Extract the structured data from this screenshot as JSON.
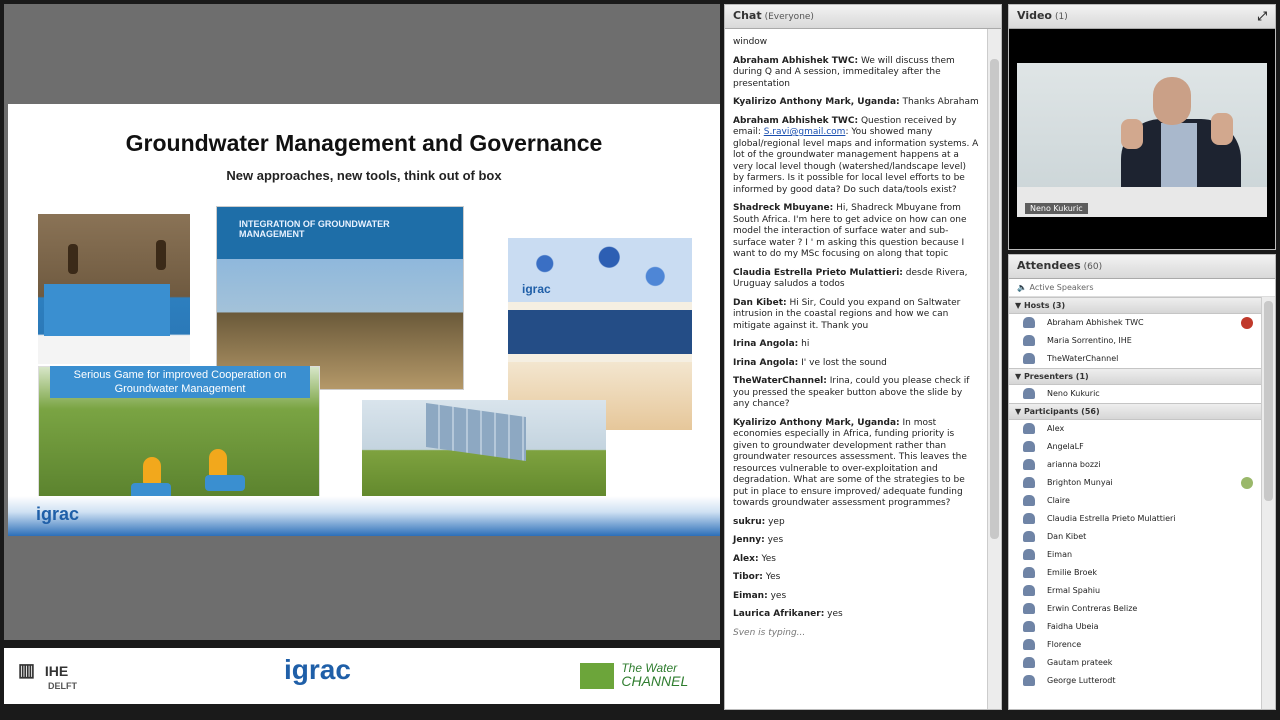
{
  "slide": {
    "title": "Groundwater Management and Governance",
    "subtitle": "New approaches, new tools, think out of box",
    "book_title": "INTEGRATION OF GROUNDWATER MANAGEMENT",
    "book3_logo": "igrac",
    "game_caption": "Serious Game for improved Cooperation on Groundwater Management",
    "footer_logo": "igrac"
  },
  "logobar": {
    "ihe": "IHE",
    "ihe_sub": "DELFT",
    "igrac": "igrac",
    "water_channel_1": "The Water",
    "water_channel_2": "CHANNEL"
  },
  "chat": {
    "title": "Chat",
    "scope": "(Everyone)",
    "messages": [
      {
        "author": "",
        "text": "window"
      },
      {
        "author": "Abraham Abhishek TWC:",
        "text": "We will discuss them during Q and A session, immeditaley after the presentation"
      },
      {
        "author": "Kyalirizo Anthony Mark, Uganda:",
        "text": "Thanks Abraham"
      },
      {
        "author": "Abraham Abhishek TWC:",
        "text": "Question received by email:",
        "link": "S.ravi@gmail.com",
        "text2": ": You showed many global/regional level maps and information systems. A lot of the groundwater management happens at a very local level though (watershed/landscape level) by farmers. Is it possible for local level efforts to be informed by good data? Do such  data/tools exist?"
      },
      {
        "author": "Shadreck Mbuyane:",
        "text": "Hi, Shadreck Mbuyane from South Africa. I'm here to get advice on how can one model the interaction of surface water and sub-surface water ? I ' m asking this question because I want to do my MSc focusing on along that topic"
      },
      {
        "author": "Claudia Estrella Prieto Mulattieri:",
        "text": "desde Rivera, Uruguay saludos a todos"
      },
      {
        "author": "Dan Kibet:",
        "text": "Hi Sir, Could you expand on Saltwater intrusion in the coastal regions and how we can mitigate against it. Thank you"
      },
      {
        "author": "Irina Angola:",
        "text": "hi"
      },
      {
        "author": "Irina Angola:",
        "text": "I' ve lost the sound"
      },
      {
        "author": "TheWaterChannel:",
        "text": "Irina, could you please check if you pressed the speaker button above the slide  by any chance?"
      },
      {
        "author": "Kyalirizo Anthony Mark, Uganda:",
        "text": "In most economies especially in Africa, funding priority is given to groundwater development rather than groundwater resources assessment. This leaves the resources vulnerable to over-exploitation and degradation. What are some of the strategies to be put in place to ensure improved/ adequate funding towards groundwater assessment programmes?"
      },
      {
        "author": "sukru:",
        "text": "yep"
      },
      {
        "author": "Jenny:",
        "text": "yes"
      },
      {
        "author": "Alex:",
        "text": "Yes"
      },
      {
        "author": "Tibor:",
        "text": "Yes"
      },
      {
        "author": "Eiman:",
        "text": "yes"
      },
      {
        "author": "Laurica Afrikaner:",
        "text": "yes"
      }
    ],
    "typing": "Sven is typing..."
  },
  "video": {
    "title": "Video",
    "count": "(1)",
    "presenter_name": "Neno Kukuric"
  },
  "attendees": {
    "title": "Attendees",
    "count": "(60)",
    "active_speakers": "Active Speakers",
    "groups": [
      {
        "label": "Hosts (3)",
        "members": [
          "Abraham Abhishek TWC",
          "Maria Sorrentino, IHE",
          "TheWaterChannel"
        ]
      },
      {
        "label": "Presenters (1)",
        "members": [
          "Neno Kukuric"
        ]
      },
      {
        "label": "Participants (56)",
        "members": [
          "Alex",
          "AngelaLF",
          "arianna bozzi",
          "Brighton Munyai",
          "Claire",
          "Claudia Estrella Prieto Mulattieri",
          "Dan Kibet",
          "Eiman",
          "Emilie Broek",
          "Ermal Spahiu",
          "Erwin Contreras Belize",
          "Faidha Ubeia",
          "Florence",
          "Gautam prateek",
          "George Lutterodt"
        ]
      }
    ]
  },
  "colors": {
    "accent_blue": "#3a8fd0",
    "igrac_blue": "#1f5fa8"
  }
}
